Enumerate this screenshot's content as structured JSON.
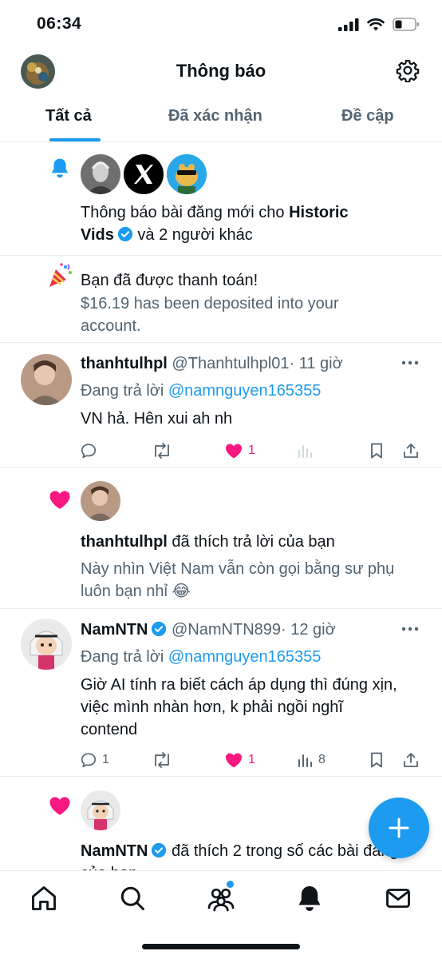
{
  "status_bar": {
    "time": "06:34"
  },
  "header": {
    "title": "Thông báo"
  },
  "tabs": [
    {
      "label": "Tất cả",
      "active": true
    },
    {
      "label": "Đã xác nhận",
      "active": false
    },
    {
      "label": "Đề cập",
      "active": false
    }
  ],
  "notifications": {
    "posts_alert": {
      "text_prefix": "Thông báo bài đăng mới cho ",
      "name_part1": "Historic",
      "name_part2": "Vids",
      "text_suffix": " và 2 người khác"
    },
    "payment": {
      "title": "Bạn đã được thanh toán!",
      "line1": "$16.19 has been deposited into your",
      "line2": "account."
    },
    "reply1": {
      "display_name": "thanhtulhpl",
      "handle": "@Thanhtulhpl01",
      "time": "· 11 giờ",
      "replying_label": "Đang trả lời ",
      "replying_to": "@namnguyen165355",
      "text": "VN hả. Hên xui ah nh",
      "likes": "1"
    },
    "like1": {
      "name": "thanhtulhpl",
      "action": " đã thích trả lời của bạn",
      "quote_line1": "Này nhìn Việt Nam vẫn còn gọi bằng sư phụ",
      "quote_line2": "luôn bạn nhỉ 😂"
    },
    "reply2": {
      "display_name": "NamNTN",
      "handle": "@NamNTN899",
      "time": "· 12 giờ",
      "replying_label": "Đang trả lời ",
      "replying_to": "@namnguyen165355",
      "text_line1": "Giờ AI tính ra biết cách áp dụng thì đúng xịn,",
      "text_line2": "việc mình nhàn hơn, k phải ngồi nghĩ",
      "text_line3": "contend",
      "replies": "1",
      "likes": "1",
      "views": "8"
    },
    "like2": {
      "name": "NamNTN",
      "action": " đã thích 2 trong số các bài đăng",
      "action_line2": "của bạn"
    }
  },
  "colors": {
    "accent": "#1d9bf0",
    "like": "#f91880",
    "muted": "#536471"
  }
}
